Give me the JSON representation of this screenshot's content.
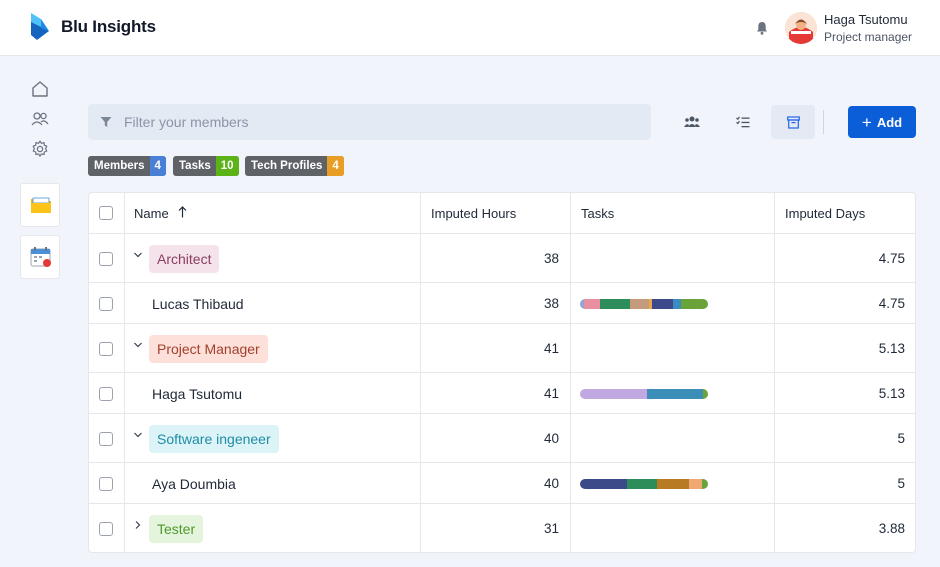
{
  "app": {
    "name": "Blu Insights",
    "brand_color": "#0b5ed7"
  },
  "user": {
    "name": "Haga Tsutomu",
    "role": "Project manager"
  },
  "sidebar": {
    "icons": [
      "home-icon",
      "users-icon",
      "settings-icon"
    ],
    "cards": [
      "folder-icon",
      "calendar-icon"
    ]
  },
  "toolbar": {
    "filter_placeholder": "Filter your members",
    "add_label": "Add",
    "views": [
      "group-view-icon",
      "task-list-icon",
      "archive-icon"
    ]
  },
  "badges": [
    {
      "label": "Members",
      "count": "4",
      "color": "#4a7fd6"
    },
    {
      "label": "Tasks",
      "count": "10",
      "color": "#5cb318"
    },
    {
      "label": "Tech Profiles",
      "count": "4",
      "color": "#e89d24"
    }
  ],
  "table": {
    "headers": {
      "name": "Name",
      "hours": "Imputed Hours",
      "tasks": "Tasks",
      "days": "Imputed Days"
    },
    "rows": [
      {
        "type": "group",
        "label": "Architect",
        "hours": "38",
        "days": "4.75",
        "bg": "#f5e3ec",
        "fg": "#8c3d62",
        "expanded": true
      },
      {
        "type": "member",
        "name": "Lucas Thibaud",
        "hours": "38",
        "days": "4.75",
        "tasks": [
          {
            "color": "#8fa4d9",
            "share": 0.03
          },
          {
            "color": "#e88fa0",
            "share": 0.13
          },
          {
            "color": "#2c8c5a",
            "share": 0.23
          },
          {
            "color": "#c39a7c",
            "share": 0.15
          },
          {
            "color": "#e7a84c",
            "share": 0.02
          },
          {
            "color": "#3d4a8a",
            "share": 0.17
          },
          {
            "color": "#3d8cc0",
            "share": 0.06
          },
          {
            "color": "#6aa33a",
            "share": 0.21
          }
        ]
      },
      {
        "type": "group",
        "label": "Project Manager",
        "hours": "41",
        "days": "5.13",
        "bg": "#fde0d9",
        "fg": "#a1402c",
        "expanded": true
      },
      {
        "type": "member",
        "name": "Haga Tsutomu",
        "hours": "41",
        "days": "5.13",
        "tasks": [
          {
            "color": "#c2a8e0",
            "share": 0.52
          },
          {
            "color": "#3a8eb8",
            "share": 0.44
          },
          {
            "color": "#6aa33a",
            "share": 0.04
          }
        ]
      },
      {
        "type": "group",
        "label": "Software ingeneer",
        "hours": "40",
        "days": "5",
        "bg": "#dcf3f7",
        "fg": "#1f8da6",
        "expanded": true
      },
      {
        "type": "member",
        "name": "Aya Doumbia",
        "hours": "40",
        "days": "5",
        "tasks": [
          {
            "color": "#3d4a8a",
            "share": 0.37
          },
          {
            "color": "#2c8c5a",
            "share": 0.23
          },
          {
            "color": "#b87a22",
            "share": 0.25
          },
          {
            "color": "#f0a772",
            "share": 0.1
          },
          {
            "color": "#6aa33a",
            "share": 0.05
          }
        ]
      },
      {
        "type": "group",
        "label": "Tester",
        "hours": "31",
        "days": "3.88",
        "bg": "#e5f4dd",
        "fg": "#4f9a2c",
        "expanded": false
      }
    ]
  }
}
